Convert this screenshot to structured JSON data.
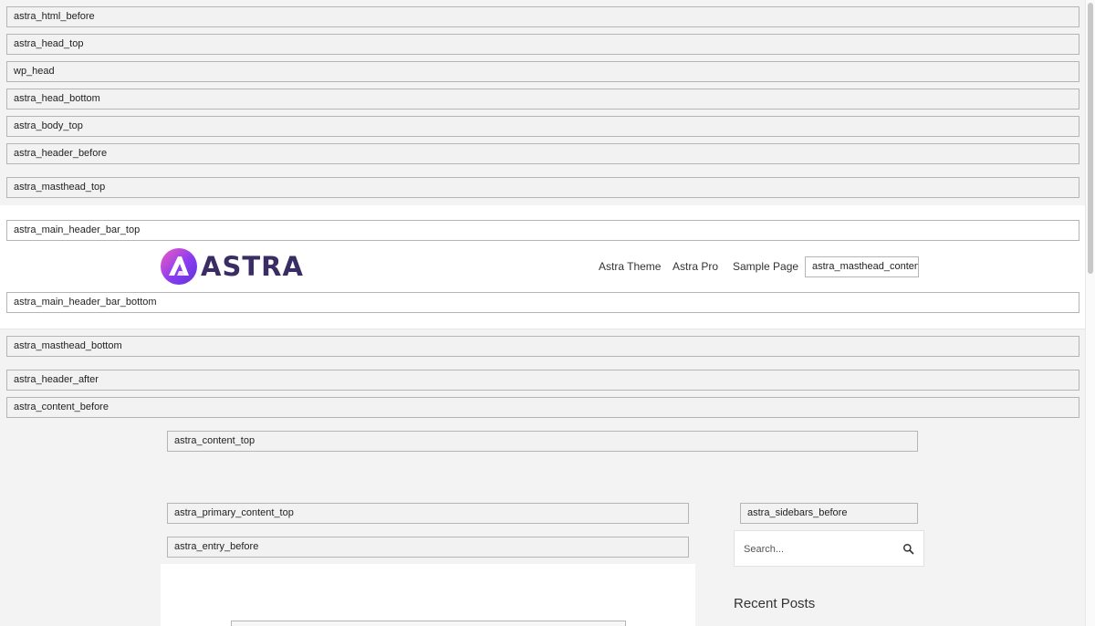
{
  "hooks": {
    "html_before": "astra_html_before",
    "head_top": "astra_head_top",
    "wp_head": "wp_head",
    "head_bottom": "astra_head_bottom",
    "body_top": "astra_body_top",
    "header_before": "astra_header_before",
    "masthead_top": "astra_masthead_top",
    "main_header_bar_top": "astra_main_header_bar_top",
    "masthead_content": "astra_masthead_content",
    "main_header_bar_bottom": "astra_main_header_bar_bottom",
    "masthead_bottom": "astra_masthead_bottom",
    "header_after": "astra_header_after",
    "content_before": "astra_content_before",
    "content_top": "astra_content_top",
    "primary_content_top": "astra_primary_content_top",
    "sidebars_before": "astra_sidebars_before",
    "entry_before": "astra_entry_before"
  },
  "header": {
    "logo_text": "ASTRA",
    "nav": [
      "Astra Theme",
      "Astra Pro",
      "Sample Page"
    ]
  },
  "sidebar": {
    "search_placeholder": "Search...",
    "search_icon": "search-icon",
    "recent_posts_title": "Recent Posts"
  },
  "colors": {
    "logo_gradient_start": "#f15ac0",
    "logo_gradient_end": "#5b34d8",
    "logo_text": "#3a2d63"
  }
}
